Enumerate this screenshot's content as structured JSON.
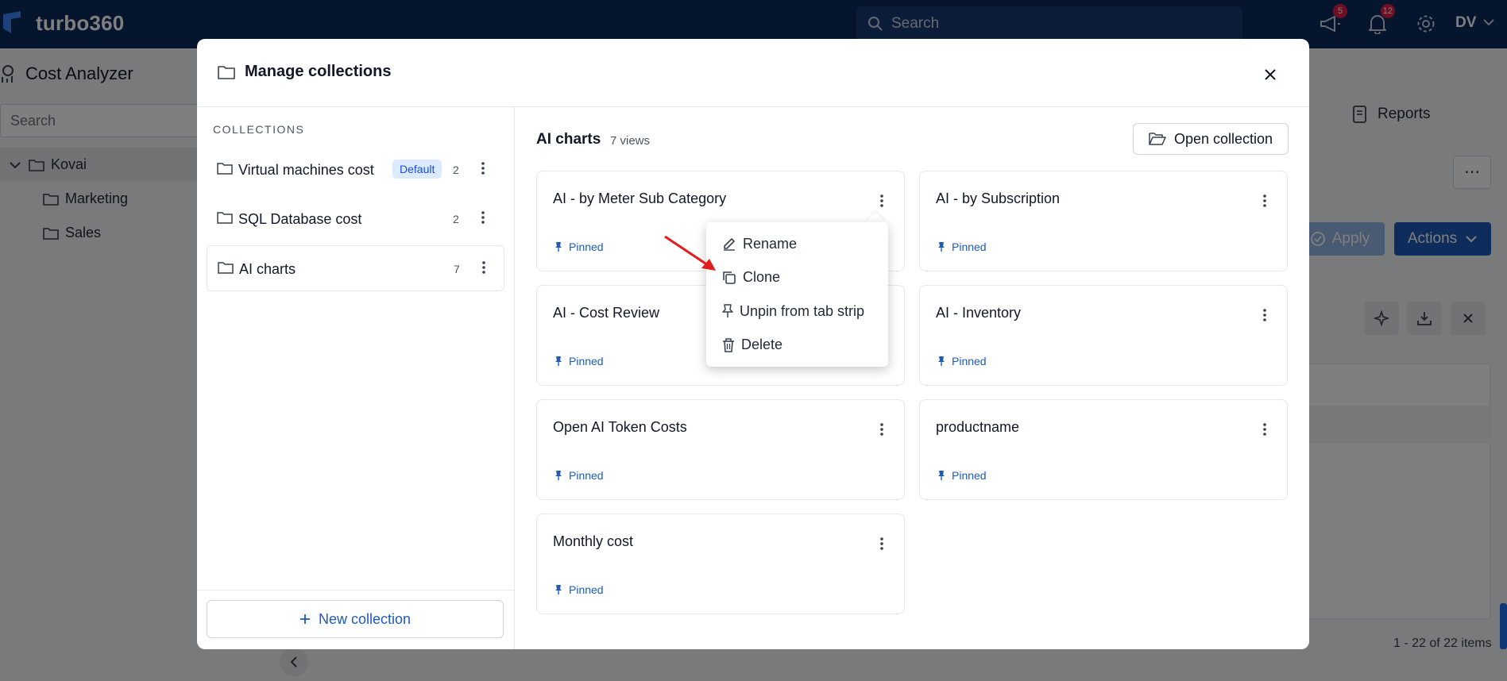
{
  "topbar": {
    "brand": "turbo360",
    "search_placeholder": "Search",
    "announce_badge": "5",
    "notif_badge": "12",
    "user_initials": "DV"
  },
  "background": {
    "page_title": "Cost Analyzer",
    "search_placeholder": "Search",
    "tree": [
      {
        "label": "Kovai"
      },
      {
        "label": "Marketing"
      },
      {
        "label": "Sales"
      }
    ],
    "reports_tab": "Reports",
    "apply_label": "Apply",
    "actions_label": "Actions",
    "pagination_text": "1 - 22 of 22 items"
  },
  "modal": {
    "title": "Manage collections",
    "collections_heading": "COLLECTIONS",
    "collections": [
      {
        "name": "Virtual machines cost",
        "badge": "Default",
        "count": "2"
      },
      {
        "name": "SQL Database cost",
        "count": "2"
      },
      {
        "name": "AI charts",
        "count": "7"
      }
    ],
    "new_collection_label": "New collection",
    "selected": {
      "title": "AI charts",
      "count_label": "7 views",
      "open_label": "Open collection"
    },
    "views": [
      {
        "name": "AI - by Meter Sub Category",
        "status": "Pinned"
      },
      {
        "name": "AI - by Subscription",
        "status": "Pinned"
      },
      {
        "name": "AI - Cost Review",
        "status": "Pinned"
      },
      {
        "name": "AI - Inventory",
        "status": "Pinned"
      },
      {
        "name": "Open AI Token Costs",
        "status": "Pinned"
      },
      {
        "name": "productname",
        "status": "Pinned"
      },
      {
        "name": "Monthly cost",
        "status": "Pinned"
      }
    ],
    "context_menu": [
      {
        "label": "Rename"
      },
      {
        "label": "Clone"
      },
      {
        "label": "Unpin from tab strip"
      },
      {
        "label": "Delete"
      }
    ]
  }
}
